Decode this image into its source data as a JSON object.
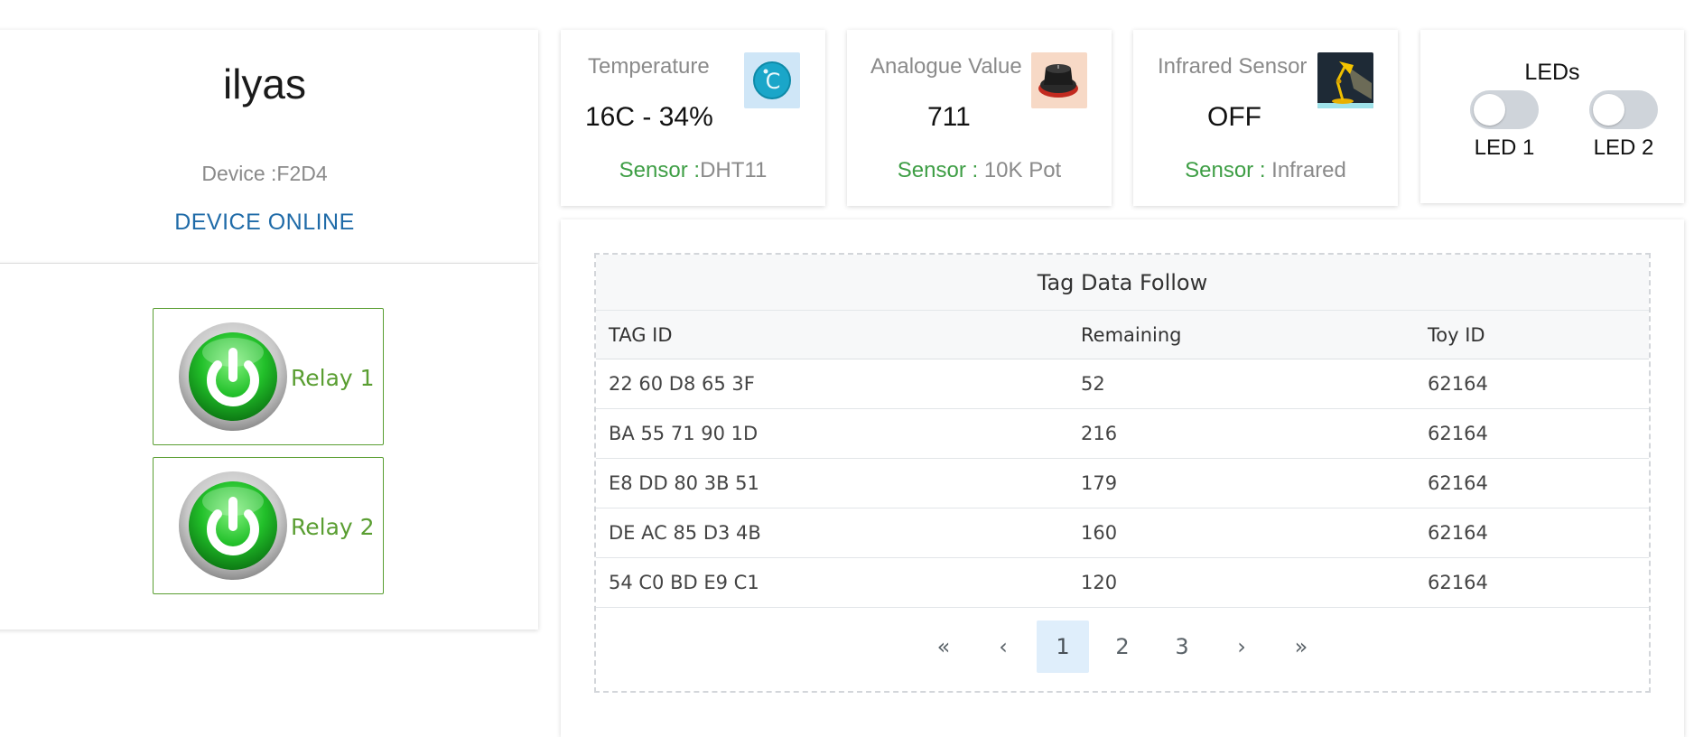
{
  "device": {
    "name": "ilyas",
    "id_text": "Device :F2D4",
    "status": "DEVICE ONLINE"
  },
  "relays": [
    {
      "label": "Relay 1",
      "icon": "power-icon"
    },
    {
      "label": "Relay 2",
      "icon": "power-icon"
    }
  ],
  "sensors": {
    "temperature": {
      "title": "Temperature",
      "value": "16C - 34%",
      "footer_label": "Sensor :",
      "footer_value": "DHT11",
      "icon": "celsius-icon"
    },
    "analogue": {
      "title": "Analogue Value",
      "value": "711",
      "footer_label": "Sensor :",
      "footer_value": " 10K Pot",
      "icon": "potentiometer-icon"
    },
    "infrared": {
      "title": "Infrared Sensor",
      "value": "OFF",
      "footer_label": "Sensor :",
      "footer_value": " Infrared",
      "icon": "lamp-icon"
    }
  },
  "leds": {
    "title": "LEDs",
    "items": [
      {
        "label": "LED 1",
        "on": false
      },
      {
        "label": "LED 2",
        "on": false
      }
    ]
  },
  "table": {
    "title": "Tag Data Follow",
    "columns": [
      "TAG ID",
      "Remaining",
      "Toy ID"
    ],
    "rows": [
      [
        "22 60 D8 65 3F",
        "52",
        "62164"
      ],
      [
        "BA 55 71 90 1D",
        "216",
        "62164"
      ],
      [
        "E8 DD 80 3B 51",
        "179",
        "62164"
      ],
      [
        "DE AC 85 D3 4B",
        "160",
        "62164"
      ],
      [
        "54 C0 BD E9 C1",
        "120",
        "62164"
      ]
    ]
  },
  "pagination": {
    "first": "«",
    "prev": "‹",
    "pages": [
      "1",
      "2",
      "3"
    ],
    "active_page": "1",
    "next": "›",
    "last": "»"
  },
  "colors": {
    "accent_green": "#3e9e45",
    "relay_green": "#5a9e32",
    "status_blue": "#1f6ba8"
  }
}
